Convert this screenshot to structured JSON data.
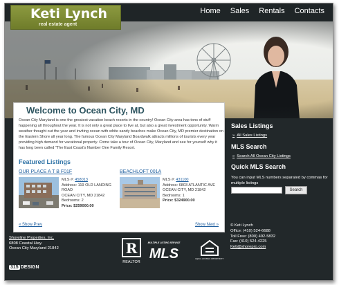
{
  "brand": {
    "name": "Keti Lynch",
    "tagline": "real estate agent"
  },
  "nav": {
    "items": [
      "Home",
      "Sales",
      "Rentals",
      "Contacts"
    ]
  },
  "main": {
    "title": "Welcome to Ocean City, MD",
    "intro": "Ocean City Maryland is one the greatest vacation beach resorts in the country! Ocean City area has tons of stuff happening all throughout the year. It is not only a great place to live at, but also a great investment opportunity. Warm weather thought out the year and inviting ocean with white sandy beaches make Ocean City, MD premier destination on the Eastern Shore all year long. The famous Ocean City Maryland Boardwalk attracts millions of tourists every year providing high demand for vacational property. Come take a tour of Ocean City, Maryland and see for yourself why it has long been called \"The East Coast's Number One Family Resort.",
    "featured_heading": "Featured Listings",
    "listings": [
      {
        "title": "OUR PLACE A T B F01F",
        "mls_label": "MLS #:",
        "mls_number": "458013",
        "address_line1": "Address: 119 OLD LANDING ROAD",
        "address_line2": "OCEAN CITY, MD 21842",
        "bedrooms": "Bedrooms: 2",
        "price": "Price: $259000.00"
      },
      {
        "title": "BEACHLOFT 001A",
        "mls_label": "MLS #:",
        "mls_number": "431100",
        "address_line1": "Address: 6803 ATLANTIC AVE",
        "address_line2": "OCEAN CITY, MD 21842",
        "bedrooms": "Bedrooms: 1",
        "price": "Price: $324900.00"
      }
    ],
    "show_prev": "« Show Prev",
    "show_next": "Show Next »"
  },
  "sidebar": {
    "sales_heading": "Sales Listings",
    "sales_link": "All Sales Listings",
    "mls_heading": "MLS Search",
    "mls_link": "Search All Ocean City Listings",
    "quick_heading": "Quick MLS Search",
    "quick_text": "You can input MLS numbers separated by commas for multiple listings",
    "quick_button": "Search",
    "link_arrow": "»"
  },
  "footer": {
    "company": "Shoreline Properties, Inc.",
    "street": "6808 Coastal Hwy.",
    "city": "Ocean City Maryland 21842",
    "copyright": "© Keti Lynch",
    "office": "Office: (410) 524-6688",
    "toll_free": "Toll Free: (800) 492-5832",
    "fax": "Fax: (410) 524-4225",
    "email": "Keti@shorepro.com",
    "realtor_label": "REALTOR",
    "mls_service": "MULTIPLE LISTING SERVICE",
    "mls_logo": "MLS",
    "equal_housing": "EQUAL HOUSING OPPORTUNITY",
    "design_box": "315",
    "design_text": "DESIGN"
  },
  "colors": {
    "background": "#22282a",
    "logo_green": "#7d8b33",
    "title_blue": "#2e5560",
    "link_blue": "#1e5e9e"
  }
}
